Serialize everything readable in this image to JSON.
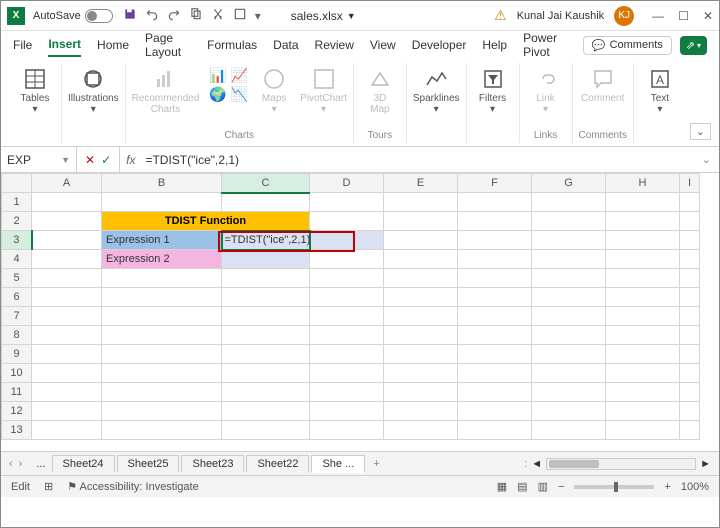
{
  "title": {
    "autosave_label": "AutoSave",
    "autosave_state": "Off",
    "filename": "sales.xlsx",
    "user_name": "Kunal Jai Kaushik",
    "user_initials": "KJ"
  },
  "tabs": {
    "file": "File",
    "insert": "Insert",
    "home": "Home",
    "pagelayout": "Page Layout",
    "formulas": "Formulas",
    "data": "Data",
    "review": "Review",
    "view": "View",
    "developer": "Developer",
    "help": "Help",
    "powerpivot": "Power Pivot",
    "comments": "Comments"
  },
  "ribbon": {
    "tables": "Tables",
    "illustrations": "Illustrations",
    "recommended": "Recommended\nCharts",
    "maps": "Maps",
    "pivotchart": "PivotChart",
    "charts_label": "Charts",
    "map3d": "3D\nMap",
    "tours": "Tours",
    "sparklines": "Sparklines",
    "filters": "Filters",
    "link": "Link",
    "links_label": "Links",
    "comment": "Comment",
    "comments_label": "Comments",
    "text": "Text"
  },
  "formula_bar": {
    "namebox": "EXP",
    "formula": "=TDIST(\"ice\",2,1)"
  },
  "sheet": {
    "header_title": "TDIST Function",
    "b3": "Expression 1",
    "c3": "=TDIST(\"ice\",2,1)",
    "b4": "Expression 2"
  },
  "cols": [
    "A",
    "B",
    "C",
    "D",
    "E",
    "F",
    "G",
    "H",
    "I"
  ],
  "sheets": {
    "s24": "Sheet24",
    "s25": "Sheet25",
    "s23": "Sheet23",
    "s22": "Sheet22",
    "active": "She",
    "dots": "...",
    "plus": "+"
  },
  "status": {
    "mode": "Edit",
    "access": "Accessibility: Investigate",
    "zoom": "100%"
  }
}
